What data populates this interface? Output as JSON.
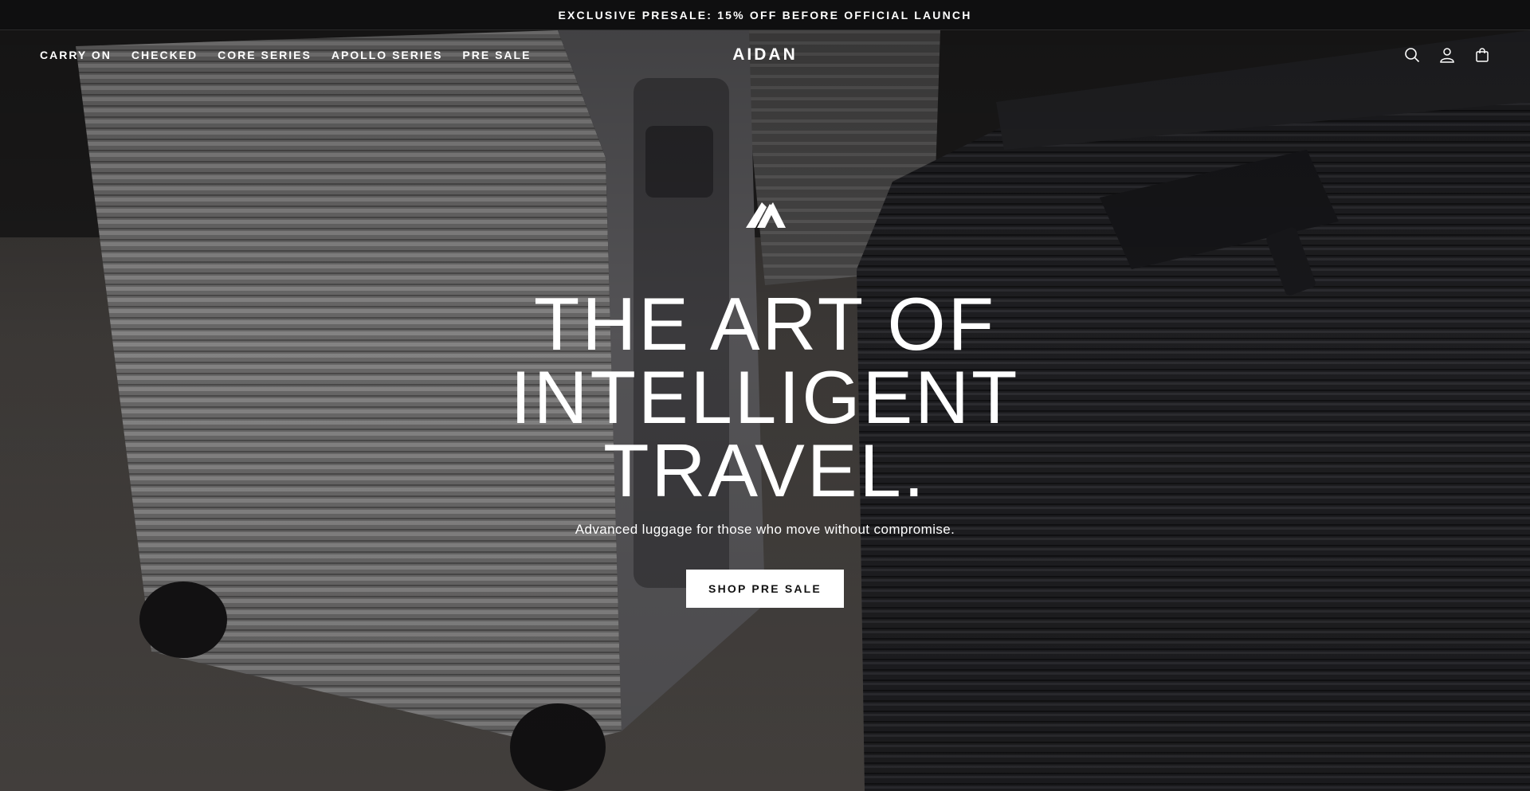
{
  "announcement": {
    "text": "EXCLUSIVE PRESALE: 15% OFF BEFORE OFFICIAL LAUNCH"
  },
  "nav": {
    "items": [
      {
        "label": "CARRY ON"
      },
      {
        "label": "CHECKED"
      },
      {
        "label": "CORE SERIES"
      },
      {
        "label": "APOLLO SERIES"
      },
      {
        "label": "PRE SALE"
      }
    ]
  },
  "brand": {
    "name": "AIDAN"
  },
  "header_icons": {
    "search": "search-icon",
    "account": "account-icon",
    "cart": "cart-icon"
  },
  "hero": {
    "headline_lines": [
      "THE ART OF",
      "INTELLIGENT",
      "TRAVEL."
    ],
    "subheading": "Advanced luggage for those who move without compromise.",
    "cta_label": "SHOP PRE SALE"
  },
  "colors": {
    "announcement_bg": "#0f0f10",
    "cta_bg": "#ffffff",
    "cta_text": "#111111"
  }
}
